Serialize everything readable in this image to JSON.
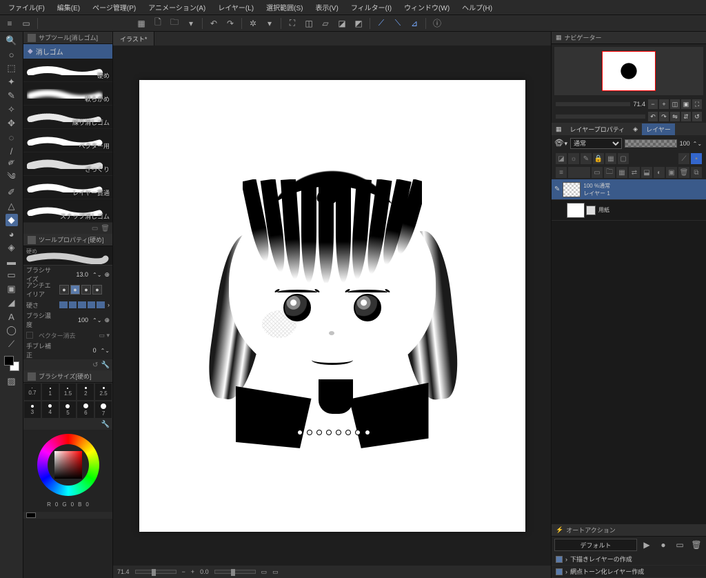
{
  "menu": [
    "ファイル(F)",
    "編集(E)",
    "ページ管理(P)",
    "アニメーション(A)",
    "レイヤー(L)",
    "選択範囲(S)",
    "表示(V)",
    "フィルター(I)",
    "ウィンドウ(W)",
    "ヘルプ(H)"
  ],
  "tab_title": "イラスト*",
  "subtool_panel": {
    "title": "サブツール[消しゴム]",
    "selected": "消しゴム",
    "brushes": [
      "硬め",
      "軟らかめ",
      "練り消しゴム",
      "ベクター用",
      "ざっくり",
      "レイヤー貫通",
      "スナップ消しゴム"
    ]
  },
  "tool_property": {
    "title": "ツールプロパティ[硬め]",
    "preset": "硬め",
    "rows": {
      "brush_size_label": "ブラシサイズ",
      "brush_size_value": "13.0",
      "antialias_label": "アンチエイリア",
      "hardness_label": "硬さ",
      "density_label": "ブラシ濃度",
      "density_value": "100",
      "vector_erase_label": "ベクター消去",
      "stabilize_label": "手ブレ補正",
      "stabilize_value": "0"
    }
  },
  "brush_size_panel": {
    "title": "ブラシサイズ[硬め]",
    "row1": [
      "0.7",
      "1",
      "1.5",
      "2",
      "2.5"
    ],
    "row2": [
      "3",
      "4",
      "5",
      "6",
      "7"
    ]
  },
  "rgb": {
    "r_label": "R",
    "r": "0",
    "g_label": "G",
    "g": "0",
    "b_label": "B",
    "b": "0"
  },
  "status": {
    "zoom": "71.4",
    "rotate": "0.0"
  },
  "navigator": {
    "title": "ナビゲーター",
    "zoom": "71.4"
  },
  "layer_panel": {
    "tab1": "レイヤープロパティ",
    "tab2": "レイヤー",
    "blend": "通常",
    "opacity": "100",
    "layers": [
      {
        "opacity": "100 %通常",
        "name": "レイヤー 1",
        "visible": true,
        "selected": true
      },
      {
        "opacity": "",
        "name": "用紙",
        "visible": true,
        "selected": false
      }
    ]
  },
  "auto_action": {
    "title": "オートアクション",
    "set": "デフォルト",
    "items": [
      "下描きレイヤーの作成",
      "網点トーン化レイヤー作成"
    ]
  }
}
